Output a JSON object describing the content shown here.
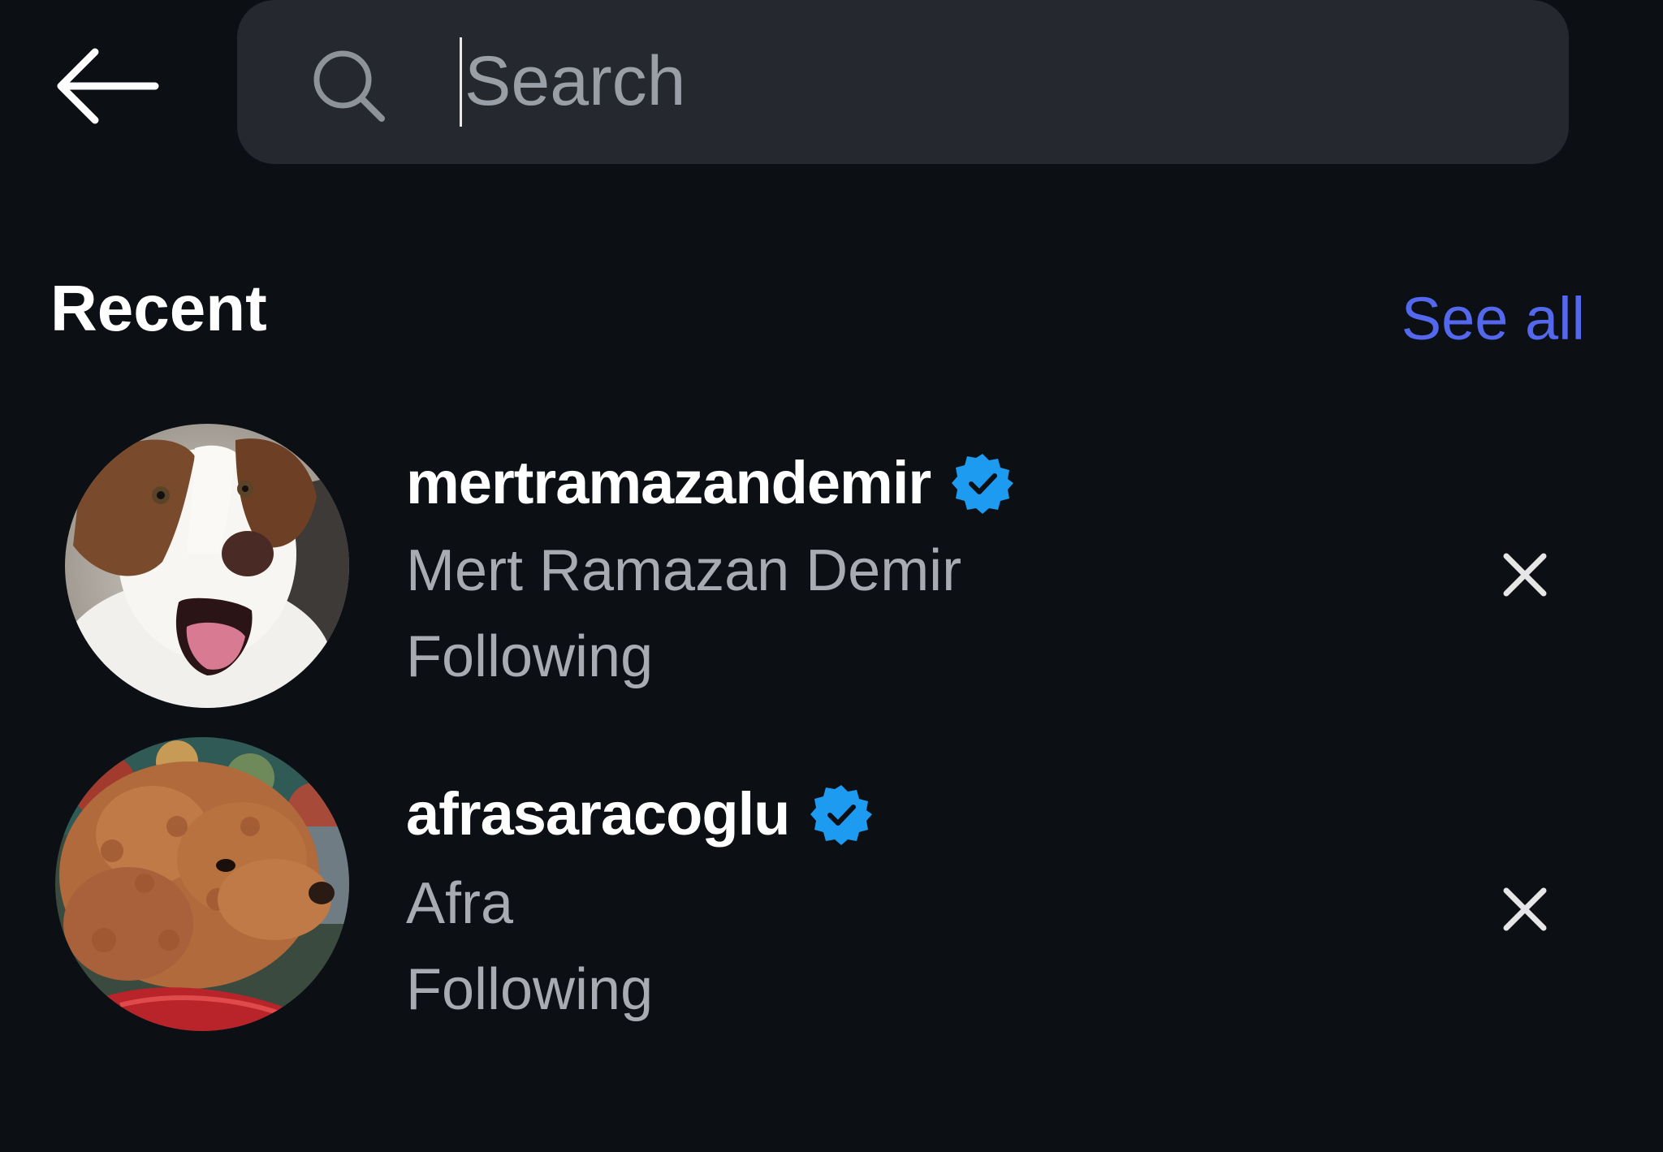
{
  "header": {
    "back_icon": "arrow-left-icon",
    "search": {
      "placeholder": "Search",
      "value": "",
      "icon": "search-icon"
    }
  },
  "recent": {
    "title": "Recent",
    "see_all_label": "See all",
    "accent_color": "#5468ee",
    "items": [
      {
        "username": "mertramazandemir",
        "verified": true,
        "verified_icon": "verified-badge-icon",
        "full_name": "Mert Ramazan Demir",
        "status": "Following",
        "avatar": "avatar-dog-border-collie",
        "remove_icon": "close-icon"
      },
      {
        "username": "afrasaracoglu",
        "verified": true,
        "verified_icon": "verified-badge-icon",
        "full_name": "Afra",
        "status": "Following",
        "avatar": "avatar-dog-poodle",
        "remove_icon": "close-icon"
      }
    ]
  },
  "colors": {
    "background": "#0c0f14",
    "search_bg": "#25282e",
    "secondary_text": "#a8acb2",
    "verified_blue": "#1d9bf0"
  }
}
